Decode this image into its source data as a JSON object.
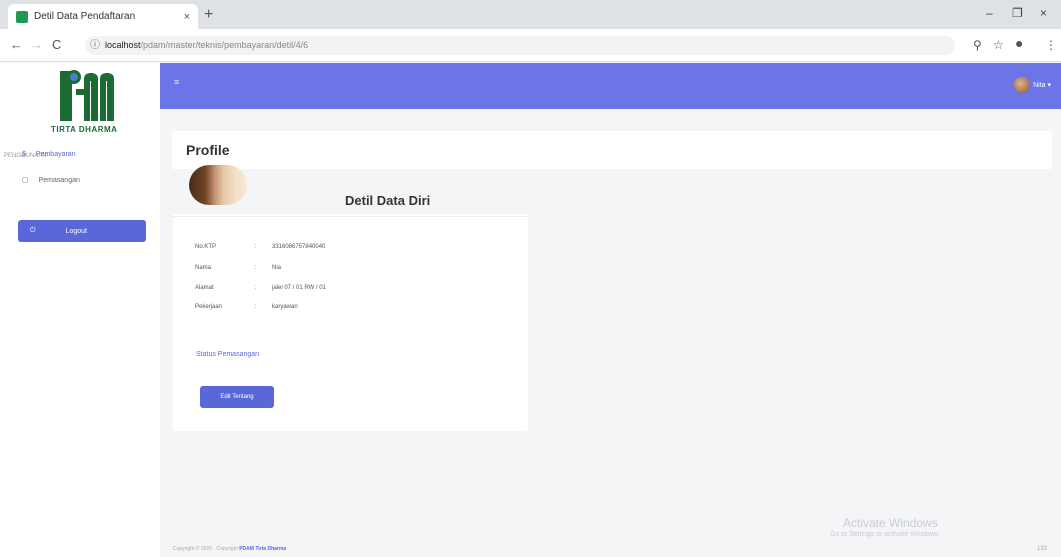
{
  "browser": {
    "tab_title": "Detil Data Pendaftaran",
    "tab_close": "×",
    "new_tab": "+",
    "url_host": "localhost",
    "url_path": "/pdam/master/teknis/pembayaran/detil/4/6",
    "win_min": "–",
    "win_max": "❐",
    "win_close": "×"
  },
  "sidebar": {
    "logo_text": "TIRTA DHARMA",
    "heading": "PENGGUNAAN",
    "items": [
      {
        "label": "Pembayaran"
      },
      {
        "label": "Pemasangan"
      }
    ],
    "logout_label": "Logout"
  },
  "topbar": {
    "user_name": "Nita"
  },
  "page": {
    "title": "Profile"
  },
  "card": {
    "title": "Detil Data Diri",
    "fields": [
      {
        "key": "No.KTP",
        "value": "3316086757840040"
      },
      {
        "key": "Nama",
        "value": "Nia"
      },
      {
        "key": "Alamat",
        "value": "jalei 07 / 01 RW / 01"
      },
      {
        "key": "Pekerjaan",
        "value": "karyawan"
      }
    ],
    "colon": ":",
    "status_link": "Status Pemasangan",
    "edit_button": "Edit Tentang"
  },
  "footer": {
    "text": "Copyright © 2020 · Copyright",
    "brand": "PDAM Tirta Dharma"
  },
  "watermark": {
    "line1": "Activate Windows",
    "line2": "Go to Settings to activate Windows."
  },
  "corner_text": "133",
  "colors": {
    "accent": "#5a67d8",
    "topbar": "#6b75e8",
    "logo_green": "#1c6b35"
  }
}
